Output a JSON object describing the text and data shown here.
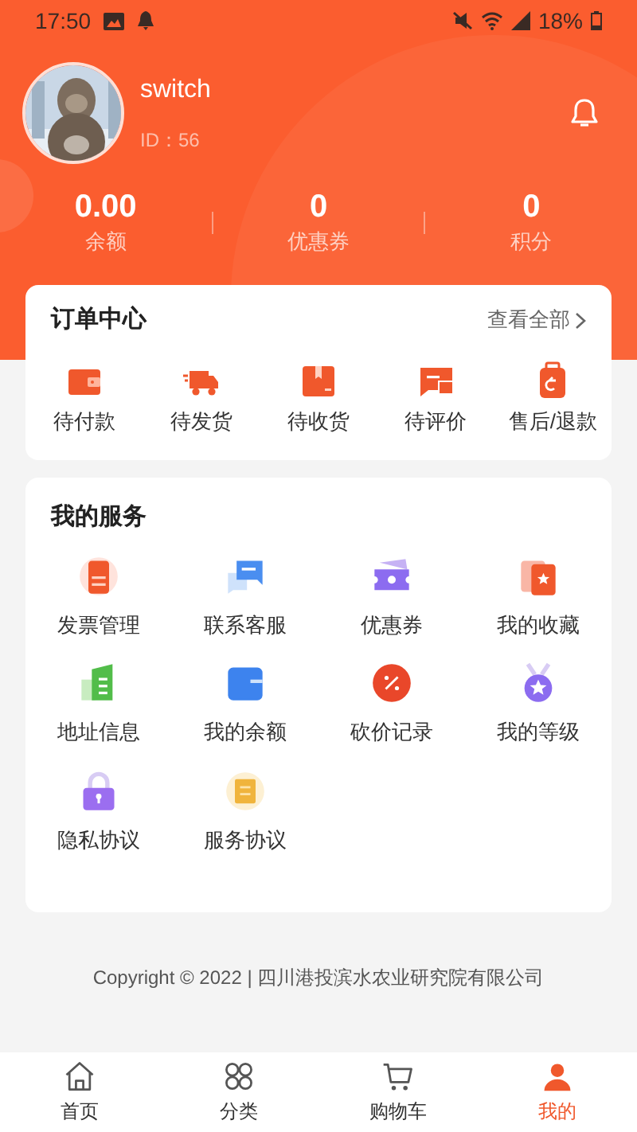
{
  "status_bar": {
    "time": "17:50",
    "battery": "18%"
  },
  "profile": {
    "name": "switch",
    "id": "ID：56"
  },
  "stats": [
    {
      "value": "0.00",
      "label": "余额"
    },
    {
      "value": "0",
      "label": "优惠券"
    },
    {
      "value": "0",
      "label": "积分"
    }
  ],
  "orders": {
    "title": "订单中心",
    "view_all": "查看全部",
    "items": [
      "待付款",
      "待发货",
      "待收货",
      "待评价",
      "售后/退款"
    ]
  },
  "services": {
    "title": "我的服务",
    "items": [
      "发票管理",
      "联系客服",
      "优惠券",
      "我的收藏",
      "地址信息",
      "我的余额",
      "砍价记录",
      "我的等级",
      "隐私协议",
      "服务协议"
    ]
  },
  "footer": "Copyright © 2022 | 四川港投滨水农业研究院有限公司",
  "tabs": [
    {
      "label": "首页",
      "selected": false
    },
    {
      "label": "分类",
      "selected": false
    },
    {
      "label": "购物车",
      "selected": false
    },
    {
      "label": "我的",
      "selected": true
    }
  ]
}
